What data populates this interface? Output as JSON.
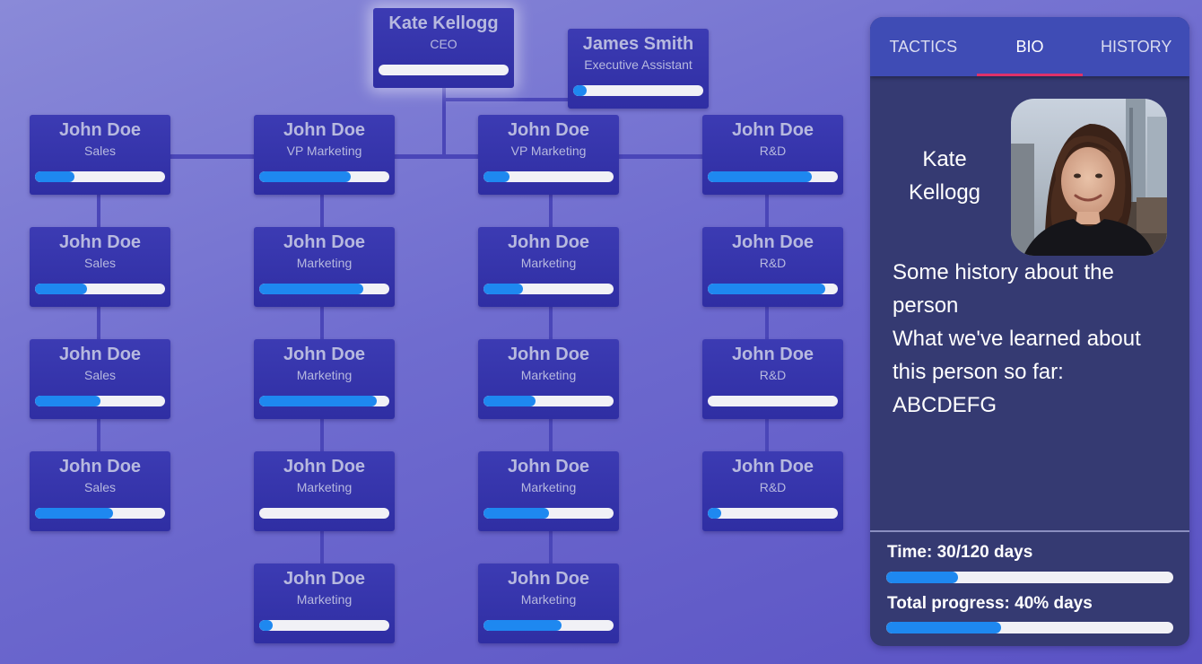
{
  "org_chart": {
    "nodes": [
      {
        "id": "ceo",
        "name": "Kate Kellogg",
        "role": "CEO",
        "progress": 0,
        "focused": true
      },
      {
        "id": "ea",
        "name": "James Smith",
        "role": "Executive Assistant",
        "progress": 0.1
      },
      {
        "id": "c1r1",
        "name": "John Doe",
        "role": "Sales",
        "progress": 0.3
      },
      {
        "id": "c1r2",
        "name": "John Doe",
        "role": "Sales",
        "progress": 0.4
      },
      {
        "id": "c1r3",
        "name": "John Doe",
        "role": "Sales",
        "progress": 0.5
      },
      {
        "id": "c1r4",
        "name": "John Doe",
        "role": "Sales",
        "progress": 0.6
      },
      {
        "id": "c2r1",
        "name": "John Doe",
        "role": "VP Marketing",
        "progress": 0.7
      },
      {
        "id": "c2r2",
        "name": "John Doe",
        "role": "Marketing",
        "progress": 0.8
      },
      {
        "id": "c2r3",
        "name": "John Doe",
        "role": "Marketing",
        "progress": 0.9
      },
      {
        "id": "c2r4",
        "name": "John Doe",
        "role": "Marketing",
        "progress": 0
      },
      {
        "id": "c2r5",
        "name": "John Doe",
        "role": "Marketing",
        "progress": 0.1
      },
      {
        "id": "c3r1",
        "name": "John Doe",
        "role": "VP Marketing",
        "progress": 0.2
      },
      {
        "id": "c3r2",
        "name": "John Doe",
        "role": "Marketing",
        "progress": 0.3
      },
      {
        "id": "c3r3",
        "name": "John Doe",
        "role": "Marketing",
        "progress": 0.4
      },
      {
        "id": "c3r4",
        "name": "John Doe",
        "role": "Marketing",
        "progress": 0.5
      },
      {
        "id": "c3r5",
        "name": "John Doe",
        "role": "Marketing",
        "progress": 0.6
      },
      {
        "id": "c4r1",
        "name": "John Doe",
        "role": "R&D",
        "progress": 0.8
      },
      {
        "id": "c4r2",
        "name": "John Doe",
        "role": "R&D",
        "progress": 0.9
      },
      {
        "id": "c4r3",
        "name": "John Doe",
        "role": "R&D",
        "progress": 0
      },
      {
        "id": "c4r4",
        "name": "John Doe",
        "role": "R&D",
        "progress": 0.1
      }
    ]
  },
  "panel": {
    "tabs": [
      {
        "label": "TACTICS",
        "active": false
      },
      {
        "label": "BIO",
        "active": true
      },
      {
        "label": "HISTORY",
        "active": false
      }
    ],
    "bio": {
      "name": "Kate Kellogg",
      "text": "Some history about the person\nWhat we've learned about this person so far: ABCDEFG"
    },
    "time_label": "Time: 30/120 days",
    "time_progress": 0.25,
    "total_label": "Total progress: 40% days",
    "total_progress": 0.4
  },
  "colors": {
    "accent": "#1e88f0",
    "tab_indicator": "#e0316a",
    "node_bg": "#3434aa",
    "panel_bg": "#353a72"
  }
}
